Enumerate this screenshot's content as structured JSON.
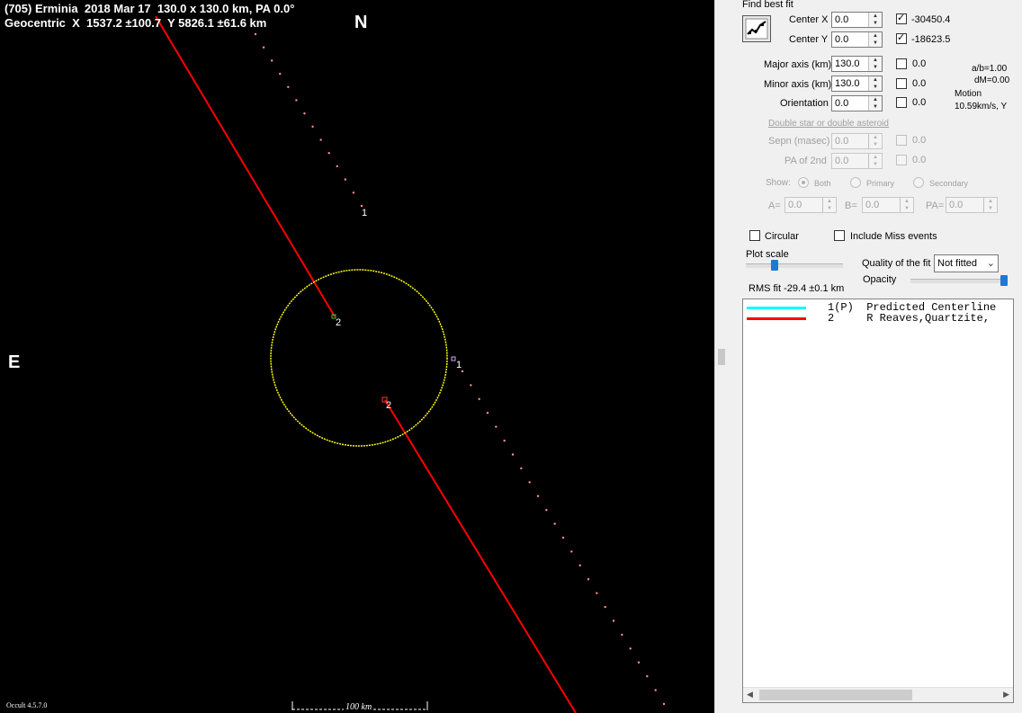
{
  "plot": {
    "title_line1": "(705) Erminia  2018 Mar 17  130.0 x 130.0 km, PA 0.0°",
    "title_line2": "Geocentric  X  1537.2 ±100.7  Y 5826.1 ±61.6 km",
    "north": "N",
    "east": "E",
    "version": "Occult 4.5.7.0",
    "scale_label": "100 km",
    "chord_labels": [
      "1",
      "2",
      "1",
      "2"
    ],
    "colors": {
      "background": "#000000",
      "ellipse": "#ffff00",
      "chord": "#ff0000",
      "path_dots": "#ff9090"
    }
  },
  "panel": {
    "group_title": "Find best fit",
    "fit_icon": "chart-fit-icon",
    "center_x": {
      "label": "Center X",
      "value": "0.0",
      "checked": true,
      "result": "-30450.4"
    },
    "center_y": {
      "label": "Center Y",
      "value": "0.0",
      "checked": true,
      "result": "-18623.5"
    },
    "major_axis": {
      "label": "Major axis (km)",
      "value": "130.0",
      "checked": false,
      "result": "0.0"
    },
    "minor_axis": {
      "label": "Minor axis (km)",
      "value": "130.0",
      "checked": false,
      "result": "0.0"
    },
    "orientation": {
      "label": "Orientation",
      "value": "0.0",
      "checked": false,
      "result": "0.0"
    },
    "ratio_ab": "a/b=1.00",
    "dm": "dM=0.00",
    "motion_label": "Motion",
    "motion_value": "10.59km/s, Y",
    "double_star_link": "Double star  or  double asteroid",
    "sepn": {
      "label": "Sepn (masec)",
      "value": "0.0",
      "result": "0.0"
    },
    "pa2nd": {
      "label": "PA of 2nd",
      "value": "0.0",
      "result": "0.0"
    },
    "show_label": "Show:",
    "show_options": [
      "Both",
      "Primary",
      "Secondary"
    ],
    "a_label": "A=",
    "a_value": "0.0",
    "b_label": "B=",
    "b_value": "0.0",
    "pa_label": "PA=",
    "pa_value": "0.0",
    "circular_label": "Circular",
    "miss_label": "Include Miss events",
    "plot_scale_label": "Plot scale",
    "quality_label": "Quality of the fit",
    "quality_value": "Not fitted",
    "opacity_label": "Opacity",
    "rms_fit": "RMS fit -29.4 ±0.1 km",
    "legend": [
      {
        "color": "#00ffff",
        "text": "1(P)  Predicted Centerline"
      },
      {
        "color": "#ff0000",
        "text": "2     R Reaves,Quartzite,"
      }
    ]
  }
}
